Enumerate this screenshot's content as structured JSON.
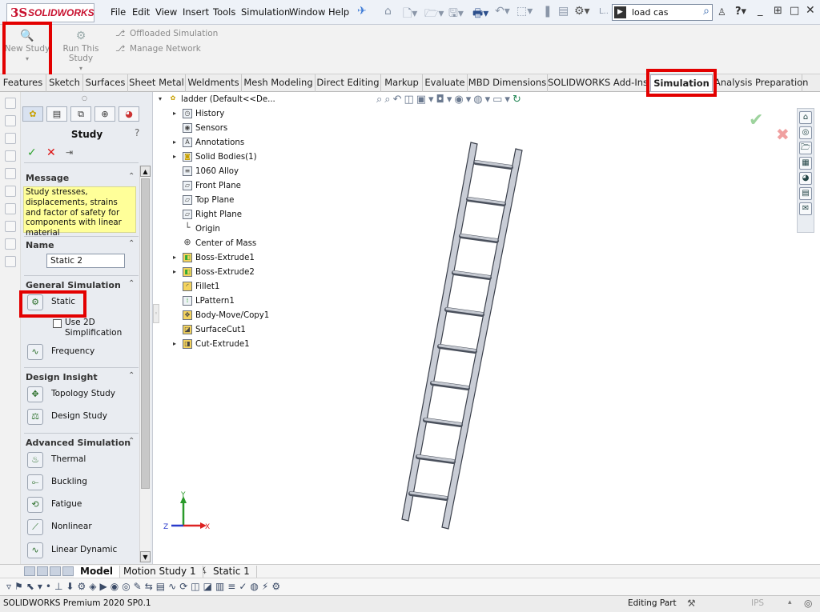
{
  "app": {
    "logo_mark": "3S",
    "logo_text": "SOLIDWORKS"
  },
  "menus": [
    "File",
    "Edit",
    "View",
    "Insert",
    "Tools",
    "Simulation",
    "Window",
    "Help"
  ],
  "search": {
    "value": "load cas"
  },
  "ribbon": {
    "new_study": "New Study",
    "run_study": "Run This Study",
    "offloaded": "Offloaded Simulation",
    "manage_network": "Manage Network"
  },
  "tabs": [
    "Features",
    "Sketch",
    "Surfaces",
    "Sheet Metal",
    "Weldments",
    "Mesh Modeling",
    "Direct Editing",
    "Markup",
    "Evaluate",
    "MBD Dimensions",
    "SOLIDWORKS Add-Ins",
    "Simulation",
    "Analysis Preparation"
  ],
  "active_tab": "Simulation",
  "panel": {
    "title": "Study",
    "help": "?",
    "message_header": "Message",
    "message": "Study stresses, displacements, strains and factor of safety for components with linear material",
    "name_header": "Name",
    "name_value": "Static 2",
    "general_header": "General Simulation",
    "static_label": "Static",
    "use2d_label": "Use 2D Simplification",
    "frequency_label": "Frequency",
    "design_header": "Design Insight",
    "topology_label": "Topology Study",
    "design_study_label": "Design Study",
    "advanced_header": "Advanced Simulation",
    "thermal_label": "Thermal",
    "buckling_label": "Buckling",
    "fatigue_label": "Fatigue",
    "nonlinear_label": "Nonlinear",
    "linear_dynamic_label": "Linear Dynamic"
  },
  "tree": {
    "root": "ladder  (Default<<De...",
    "items": [
      "History",
      "Sensors",
      "Annotations",
      "Solid Bodies(1)",
      "1060 Alloy",
      "Front Plane",
      "Top Plane",
      "Right Plane",
      "Origin",
      "Center of Mass",
      "Boss-Extrude1",
      "Boss-Extrude2",
      "Fillet1",
      "LPattern1",
      "Body-Move/Copy1",
      "SurfaceCut1",
      "Cut-Extrude1"
    ]
  },
  "triad": {
    "x": "X",
    "y": "Y",
    "z": "Z"
  },
  "bottom_tabs": {
    "model": "Model",
    "motion": "Motion Study 1",
    "static": "Static 1"
  },
  "status": {
    "product": "SOLIDWORKS Premium 2020 SP0.1",
    "mode": "Editing Part",
    "units": "IPS"
  },
  "colors": {
    "highlight": "#e30000",
    "message_bg": "#ffff99",
    "accept": "#2ea32e",
    "reject": "#d11111"
  }
}
